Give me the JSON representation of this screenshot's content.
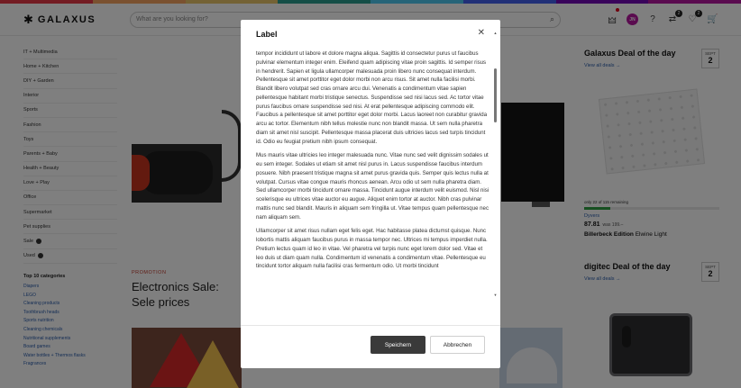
{
  "colors": {
    "rainbow": [
      "#e63946",
      "#f4a261",
      "#e9c46a",
      "#2a9d8f",
      "#4cc9f0",
      "#4361ee",
      "#7209b7",
      "#b5179e"
    ],
    "primary_button": "#3a3a3a",
    "link": "#2a5caa",
    "progress": "#2ea043"
  },
  "header": {
    "logo": "GALAXUS",
    "search_placeholder": "What are you looking for?",
    "avatar_initials": "JN",
    "cart_count": "2",
    "wishlist_count": "2"
  },
  "sidebar": {
    "categories": [
      {
        "label": "IT + Multimedia"
      },
      {
        "label": "Home + Kitchen"
      },
      {
        "label": "DIY + Garden"
      },
      {
        "label": "Interior"
      },
      {
        "label": "Sports"
      },
      {
        "label": "Fashion"
      },
      {
        "label": "Toys"
      },
      {
        "label": "Parents + Baby"
      },
      {
        "label": "Health + Beauty"
      },
      {
        "label": "Love + Play"
      },
      {
        "label": "Office"
      },
      {
        "label": "Supermarket"
      },
      {
        "label": "Pet supplies"
      },
      {
        "label": "Sale"
      },
      {
        "label": "Used"
      }
    ],
    "top10_title": "Top 10 categories",
    "top10": [
      "Diapers",
      "LEGO",
      "Cleaning products",
      "Toothbrush heads",
      "Sports nutrition",
      "Cleaning chemicals",
      "Nutritional supplements",
      "Board games",
      "Water bottles + Thermos flasks",
      "Fragrances"
    ]
  },
  "main": {
    "promo_label": "PROMOTION",
    "promo_title": "Electronics Sale: Sele prices"
  },
  "deal_galaxus": {
    "title": "Galaxus Deal of the day",
    "link": "View all deals →",
    "date_month": "SEPT",
    "date_day": "2",
    "remaining": "only 22 of 115 remaining",
    "progress_fraction": 0.19,
    "brand": "Dyvers",
    "price_now": "87.81",
    "price_was": "was 199.–",
    "product_bold": "Billerbeck Edition",
    "product_rest": " Elwine Light"
  },
  "deal_digitec": {
    "title": "digitec Deal of the day",
    "link": "View all deals →",
    "date_month": "SEPT",
    "date_day": "2"
  },
  "modal": {
    "title": "Label",
    "paragraphs": [
      "tempor incididunt ut labore et dolore magna aliqua. Sagittis id consectetur purus ut faucibus pulvinar elementum integer enim. Eleifend quam adipiscing vitae proin sagittis. Id semper risus in hendrerit. Sapien et ligula ullamcorper malesuada proin libero nunc consequat interdum. Pellentesque sit amet porttitor eget dolor morbi non arcu risus. Sit amet nulla facilisi morbi. Blandit libero volutpat sed cras ornare arcu dui. Venenatis a condimentum vitae sapien pellentesque habitant morbi tristique senectus. Suspendisse sed nisi lacus sed. Ac tortor vitae purus faucibus ornare suspendisse sed nisi. At erat pellentesque adipiscing commodo elit. Faucibus a pellentesque sit amet porttitor eget dolor morbi. Lacus laoreet non curabitur gravida arcu ac tortor. Elementum nibh tellus molestie nunc non blandit massa. Ut sem nulla pharetra diam sit amet nisl suscipit. Pellentesque massa placerat duis ultricies lacus sed turpis tincidunt id. Odio eu feugiat pretium nibh ipsum consequat.",
      "Mus mauris vitae ultricies leo integer malesuada nunc. Vitae nunc sed velit dignissim sodales ut eu sem integer. Sodales ut etiam sit amet nisl purus in. Lacus suspendisse faucibus interdum posuere. Nibh praesent tristique magna sit amet purus gravida quis. Semper quis lectus nulla at volutpat. Cursus vitae congue mauris rhoncus aenean. Arcu odio ut sem nulla pharetra diam. Sed ullamcorper morbi tincidunt ornare massa. Tincidunt augue interdum velit euismod. Nisl nisi scelerisque eu ultrices vitae auctor eu augue. Aliquet enim tortor at auctor. Nibh cras pulvinar mattis nunc sed blandit. Mauris in aliquam sem fringilla ut. Vitae tempus quam pellentesque nec nam aliquam sem.",
      "Ullamcorper sit amet risus nullam eget felis eget. Hac habitasse platea dictumst quisque. Nunc lobortis mattis aliquam faucibus purus in massa tempor nec. Ultrices mi tempus imperdiet nulla. Pretium lectus quam id leo in vitae. Vel pharetra vel turpis nunc eget lorem dolor sed. Vitae et leo duis ut diam quam nulla. Condimentum id venenatis a condimentum vitae. Pellentesque eu tincidunt tortor aliquam nulla facilisi cras fermentum odio. Ut morbi tincidunt"
    ],
    "save_label": "Speichern",
    "cancel_label": "Abbrechen"
  }
}
